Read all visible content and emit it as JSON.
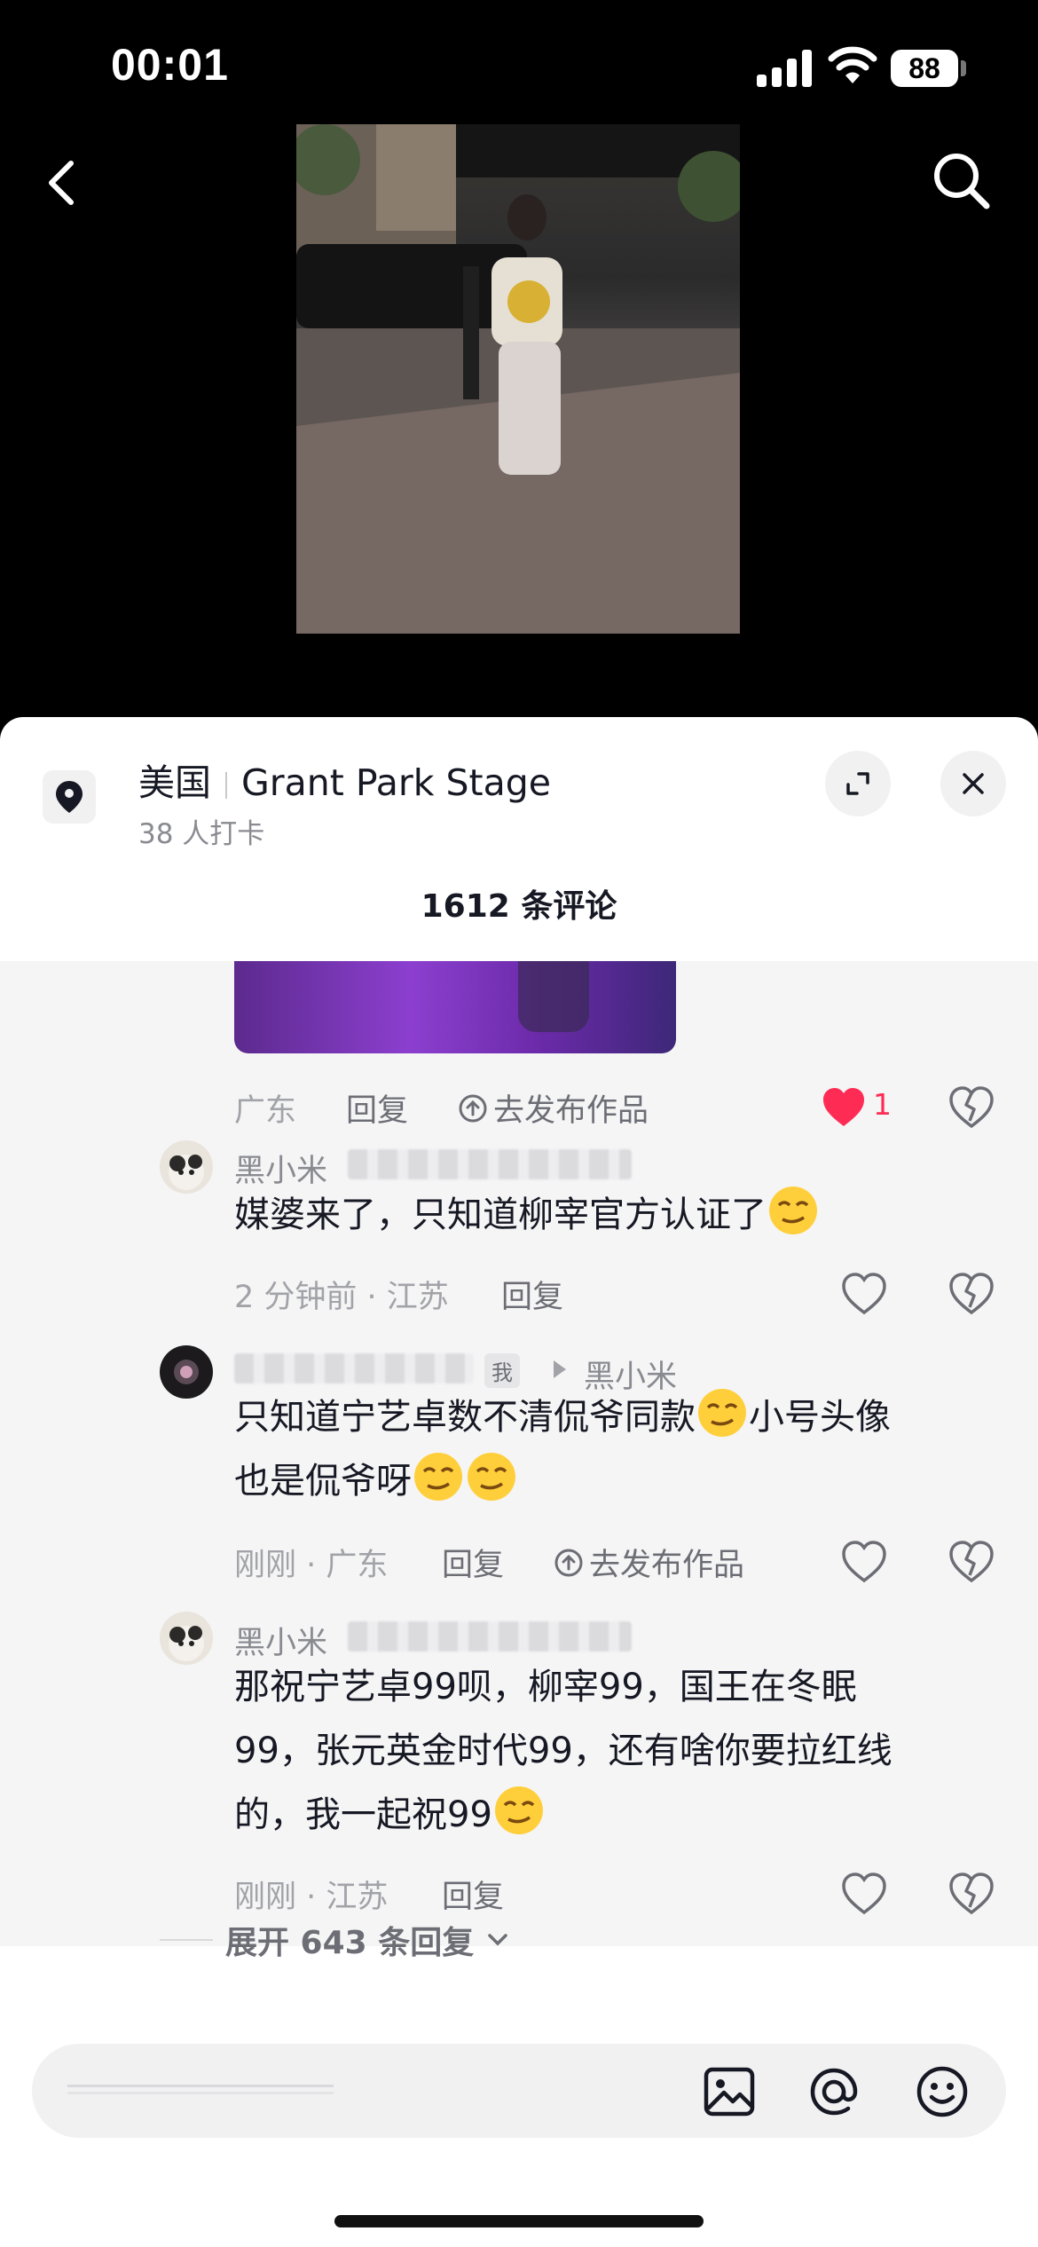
{
  "status_bar": {
    "time": "00:01",
    "battery": "88"
  },
  "location": {
    "country": "美国",
    "place": "Grant Park Stage",
    "checkins": "38 人打卡"
  },
  "comment_count": "1612 条评论",
  "top_comment": {
    "region": "广东",
    "reply": "回复",
    "publish": "去发布作品",
    "likes": "1"
  },
  "comments": [
    {
      "username": "黑小米",
      "lines": [
        "媒婆来了，只知道柳宰官方认证了"
      ],
      "meta": "2 分钟前 · 江苏",
      "reply": "回复"
    },
    {
      "tag": "我",
      "reply_to": "黑小米",
      "lines": [
        "只知道宁艺卓数不清侃爷同款",
        "小号头像",
        "也是侃爷呀"
      ],
      "meta": "刚刚 · 广东",
      "reply": "回复",
      "publish": "去发布作品"
    },
    {
      "username": "黑小米",
      "lines": [
        "那祝宁艺卓99呗，柳宰99，国王在冬眠",
        "99，张元英金时代99，还有啥你要拉红线",
        "的，我一起祝99"
      ],
      "meta": "刚刚 · 江苏",
      "reply": "回复"
    }
  ],
  "expand_replies": "展开 643 条回复",
  "colors": {
    "accent_red": "#fe2c55",
    "sheet_bg": "#ffffff",
    "comments_bg": "#f5f5f6"
  }
}
